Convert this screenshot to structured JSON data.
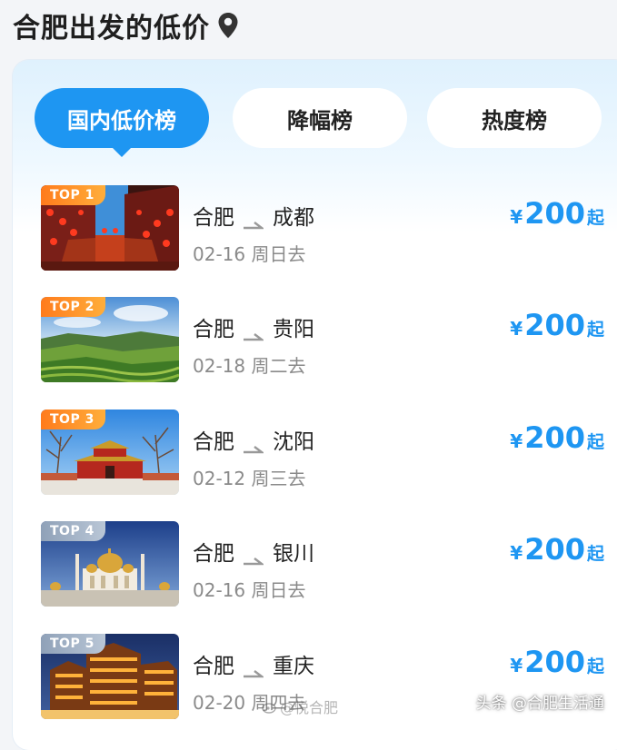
{
  "header": {
    "title": "合肥出发的低价",
    "icon": "location-pin-icon"
  },
  "tabs": [
    {
      "label": "国内低价榜",
      "active": true
    },
    {
      "label": "降幅榜",
      "active": false
    },
    {
      "label": "热度榜",
      "active": false
    }
  ],
  "routes": [
    {
      "badge": "TOP 1",
      "origin": "合肥",
      "destination": "成都",
      "date": "02-16 周日去",
      "currency": "¥",
      "price": "200",
      "suffix": "起"
    },
    {
      "badge": "TOP 2",
      "origin": "合肥",
      "destination": "贵阳",
      "date": "02-18 周二去",
      "currency": "¥",
      "price": "200",
      "suffix": "起"
    },
    {
      "badge": "TOP 3",
      "origin": "合肥",
      "destination": "沈阳",
      "date": "02-12 周三去",
      "currency": "¥",
      "price": "200",
      "suffix": "起"
    },
    {
      "badge": "TOP 4",
      "origin": "合肥",
      "destination": "银川",
      "date": "02-16 周日去",
      "currency": "¥",
      "price": "200",
      "suffix": "起"
    },
    {
      "badge": "TOP 5",
      "origin": "合肥",
      "destination": "重庆",
      "date": "02-20 周四去",
      "currency": "¥",
      "price": "200",
      "suffix": "起"
    }
  ],
  "watermarks": {
    "weibo": "@悦合肥",
    "toutiao": "头条 @合肥生活通"
  },
  "colors": {
    "accent": "#1e96f2",
    "badge_top3": "#ff7b1c",
    "badge_other": "#8fa1b8"
  }
}
